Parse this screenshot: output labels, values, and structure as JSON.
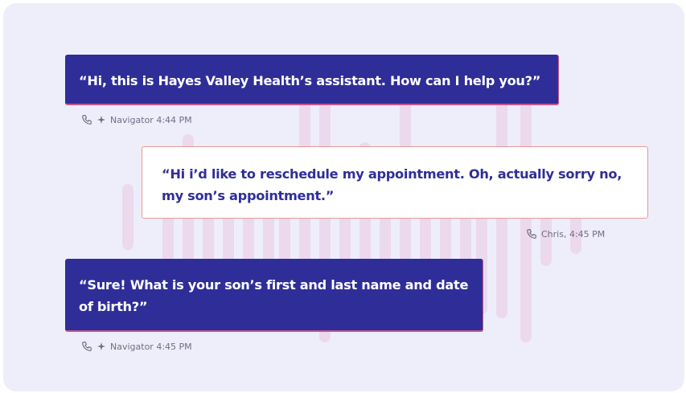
{
  "conversation": {
    "messages": [
      {
        "role": "assistant",
        "text": "“Hi, this is Hayes Valley Health’s assistant. How can I help you?”",
        "meta": "Navigator 4:44 PM",
        "icons": [
          "phone-icon",
          "sparkle-icon"
        ]
      },
      {
        "role": "user",
        "text": "“Hi i’d like to reschedule my appointment. Oh, actually sorry no, my son’s appointment.”",
        "meta": "Chris, 4:45 PM",
        "icons": [
          "phone-icon"
        ]
      },
      {
        "role": "assistant",
        "text": "“Sure! What is your son’s first and last name and date of birth?”",
        "meta": "Navigator 4:45 PM",
        "icons": [
          "phone-icon",
          "sparkle-icon"
        ]
      }
    ]
  },
  "colors": {
    "background": "#eeeefb",
    "assistant_bubble": "#2f2e98",
    "user_text": "#2f2e98",
    "accent_border": "#c7578f",
    "waveform": "#f1d6ee",
    "meta_text": "#6d6e84"
  }
}
